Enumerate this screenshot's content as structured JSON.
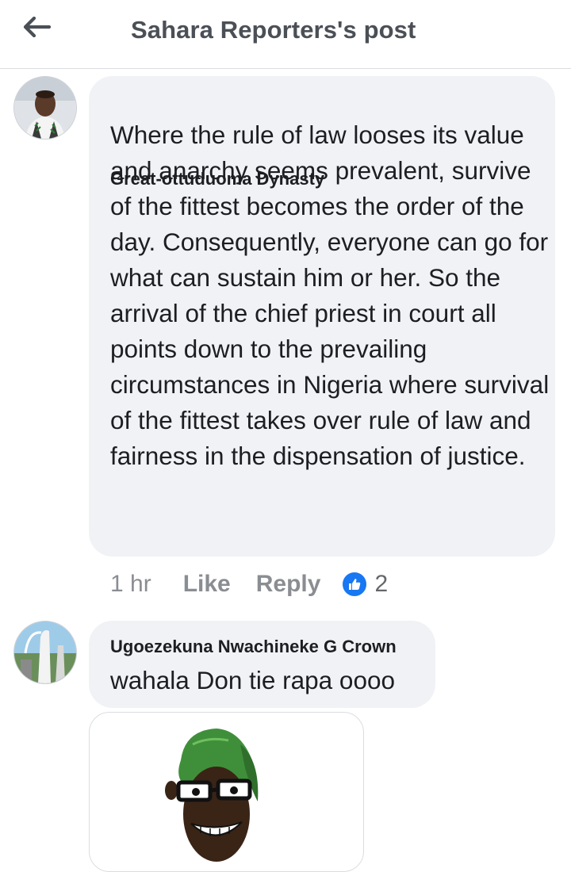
{
  "header": {
    "title": "Sahara Reporters's post",
    "back_icon": "arrow-left-icon"
  },
  "comments": [
    {
      "author": "Great-ottuduoma Dynasty",
      "text": "Where the rule of law looses its value and anarchy seems prevalent, survive of the fittest becomes the order of the day. Consequently, everyone can go for what can sustain him or her. So the arrival of the chief priest in court all points down to the prevailing circumstances in Nigeria where survival of the fittest takes over rule of law and fairness in the dispensation of justice.",
      "time": "1 hr",
      "like_label": "Like",
      "reply_label": "Reply",
      "reaction_count": "2",
      "reaction_icon": "thumbs-up-icon"
    },
    {
      "author": "Ugoezekuna Nwachineke G Crown",
      "text": "wahala Don tie rapa oooo",
      "attachment": "cartoon-sticker"
    }
  ],
  "colors": {
    "bubble": "#f0f2f5",
    "accent": "#1877f2",
    "meta": "#8a8d91"
  }
}
